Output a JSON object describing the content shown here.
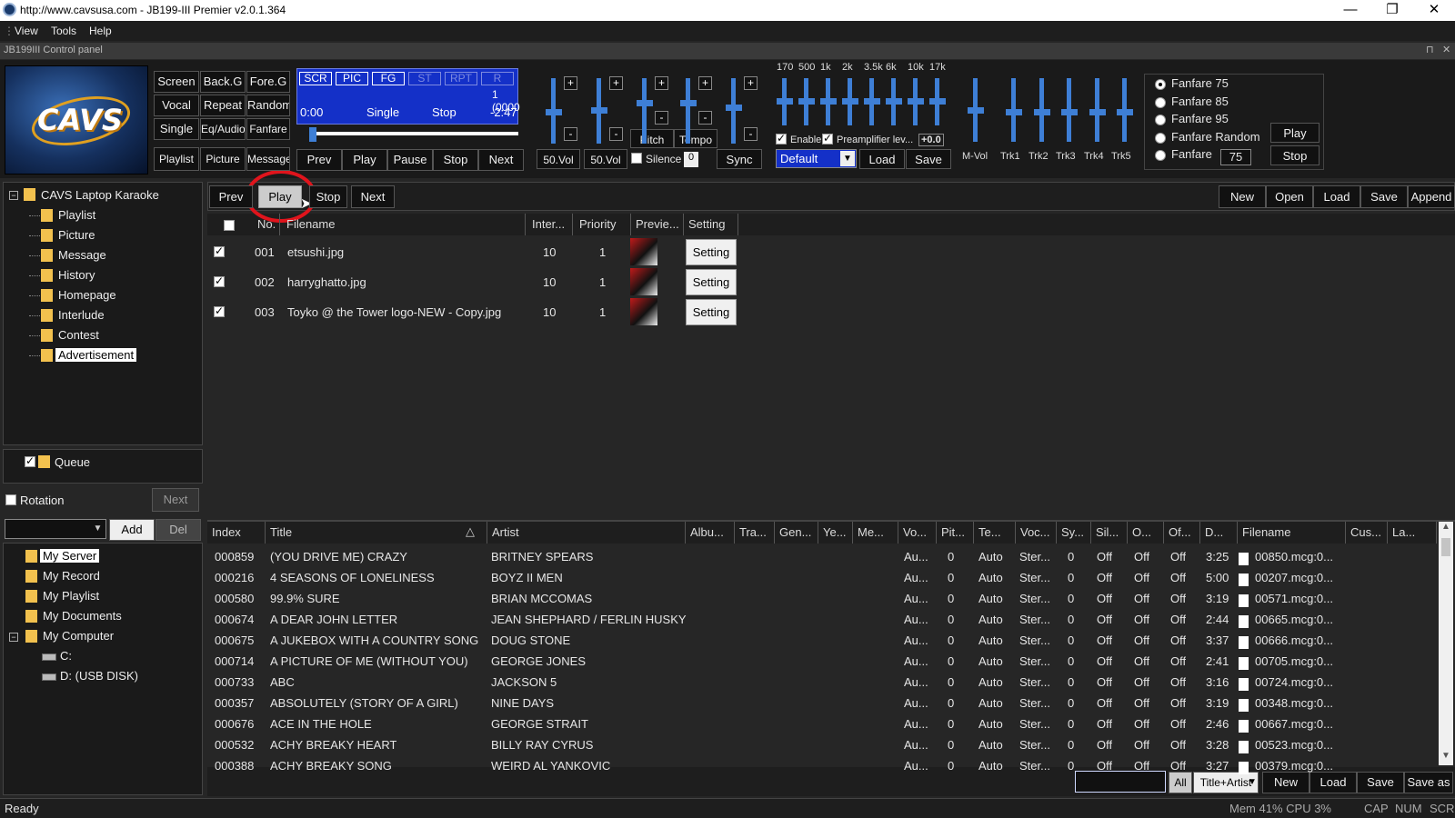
{
  "window": {
    "title": "http://www.cavsusa.com - JB199-III Premier v2.0.1.364"
  },
  "menu": [
    "View",
    "Tools",
    "Help"
  ],
  "control_panel": {
    "title": "JB199III Control panel"
  },
  "logo": {
    "text": "CAVS"
  },
  "mode_buttons": [
    [
      "Screen",
      "Back.G",
      "Fore.G"
    ],
    [
      "Vocal",
      "Repeat",
      "Random"
    ],
    [
      "Single",
      "Eq/Audio",
      "Fanfare"
    ],
    [
      "Playlist",
      "Picture",
      "Message"
    ]
  ],
  "display": {
    "tags": [
      "SCR",
      "PIC",
      "FG",
      "ST",
      "RPT",
      "R"
    ],
    "count": "1 (0000",
    "time": "0:00",
    "mode": "Single",
    "state": "Stop",
    "remaining": "-2:47"
  },
  "transport": [
    "Prev",
    "Play",
    "Pause",
    "Stop",
    "Next"
  ],
  "vol_labels": [
    "50.Vol",
    "50.Vol"
  ],
  "pitch_label": "Pitch",
  "tempo_label": "Tempo",
  "silence_label": "Silence",
  "silence_value": "0",
  "sync_label": "Sync",
  "eq": {
    "bands": [
      "170",
      "500",
      "1k",
      "2k",
      "3.5k",
      "6k",
      "10k",
      "17k"
    ],
    "enable_label": "Enable",
    "preamp_label": "Preamplifier lev...",
    "preamp_value": "+0.0",
    "preset": "Default",
    "load": "Load",
    "save": "Save"
  },
  "mixer": [
    "M-Vol",
    "Trk1",
    "Trk2",
    "Trk3",
    "Trk4",
    "Trk5"
  ],
  "fanfare": {
    "options": [
      "Fanfare 75",
      "Fanfare 85",
      "Fanfare 95",
      "Fanfare Random",
      "Fanfare"
    ],
    "custom_value": "75",
    "play": "Play",
    "stop": "Stop"
  },
  "left_tree": {
    "root": "CAVS Laptop Karaoke",
    "items": [
      "Playlist",
      "Picture",
      "Message",
      "History",
      "Homepage",
      "Interlude",
      "Contest",
      "Advertisement"
    ]
  },
  "queue": {
    "label": "Queue",
    "rotation": "Rotation",
    "next": "Next"
  },
  "lib_controls": {
    "add": "Add",
    "del": "Del"
  },
  "lib_tree": {
    "items": [
      "My Server",
      "My Record",
      "My Playlist",
      "My Documents",
      "My Computer"
    ],
    "drives": [
      "C:",
      "D: (USB DISK)"
    ]
  },
  "ad_toolbar": {
    "left": [
      "Prev",
      "Play",
      "Stop",
      "Next"
    ],
    "right": [
      "New",
      "Open",
      "Load",
      "Save",
      "Append"
    ]
  },
  "ad_table": {
    "headers": [
      "No.",
      "Filename",
      "Inter...",
      "Priority",
      "Previe...",
      "Setting"
    ],
    "rows": [
      {
        "no": "001",
        "file": "etsushi.jpg",
        "inter": "10",
        "priority": "1",
        "setting": "Setting"
      },
      {
        "no": "002",
        "file": "harryghatto.jpg",
        "inter": "10",
        "priority": "1",
        "setting": "Setting"
      },
      {
        "no": "003",
        "file": "Toyko @ the Tower logo-NEW - Copy.jpg",
        "inter": "10",
        "priority": "1",
        "setting": "Setting"
      }
    ]
  },
  "song_table": {
    "headers": [
      "Index",
      "Title",
      "Artist",
      "Albu...",
      "Tra...",
      "Gen...",
      "Ye...",
      "Me...",
      "Vo...",
      "Pit...",
      "Te...",
      "Voc...",
      "Sy...",
      "Sil...",
      "O...",
      "Of...",
      "D...",
      "Filename",
      "Cus...",
      "La..."
    ],
    "rows": [
      [
        "000859",
        "(YOU DRIVE ME) CRAZY",
        "BRITNEY SPEARS",
        "3:25",
        "00850.mcg:0..."
      ],
      [
        "000216",
        "4 SEASONS OF LONELINESS",
        "BOYZ II MEN",
        "5:00",
        "00207.mcg:0..."
      ],
      [
        "000580",
        "99.9% SURE",
        "BRIAN MCCOMAS",
        "3:19",
        "00571.mcg:0..."
      ],
      [
        "000674",
        "A DEAR JOHN LETTER",
        "JEAN SHEPHARD / FERLIN HUSKY",
        "2:44",
        "00665.mcg:0..."
      ],
      [
        "000675",
        "A JUKEBOX WITH A COUNTRY SONG",
        "DOUG STONE",
        "3:37",
        "00666.mcg:0..."
      ],
      [
        "000714",
        "A PICTURE OF ME (WITHOUT YOU)",
        "GEORGE JONES",
        "2:41",
        "00705.mcg:0..."
      ],
      [
        "000733",
        "ABC",
        "JACKSON 5",
        "3:16",
        "00724.mcg:0..."
      ],
      [
        "000357",
        "ABSOLUTELY (STORY OF A GIRL)",
        "NINE DAYS",
        "3:19",
        "00348.mcg:0..."
      ],
      [
        "000676",
        "ACE IN THE HOLE",
        "GEORGE STRAIT",
        "2:46",
        "00667.mcg:0..."
      ],
      [
        "000532",
        "ACHY BREAKY HEART",
        "BILLY RAY CYRUS",
        "3:28",
        "00523.mcg:0..."
      ],
      [
        "000388",
        "ACHY BREAKY SONG",
        "WEIRD AL YANKOVIC",
        "3:27",
        "00379.mcg:0..."
      ]
    ],
    "common": {
      "vo": "Au...",
      "pit": "0",
      "te": "Auto",
      "voc": "Ster...",
      "sy": "0",
      "sil": "Off",
      "o": "Off",
      "of": "Off"
    }
  },
  "song_toolbar": {
    "all": "All",
    "filter": "Title+Artist",
    "new": "New",
    "load": "Load",
    "save": "Save",
    "saveas": "Save as"
  },
  "status": {
    "left": "Ready",
    "mem": "Mem 41% CPU  3%",
    "caps": "CAP",
    "num": "NUM",
    "scr": "SCR"
  }
}
